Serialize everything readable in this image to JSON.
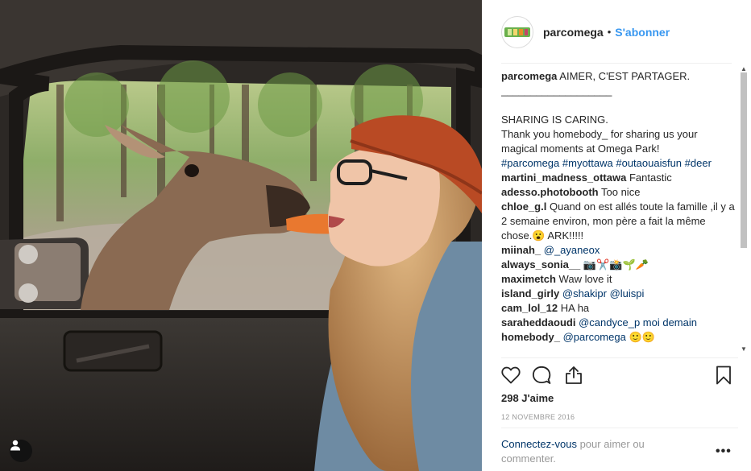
{
  "post": {
    "username": "parcomega",
    "follow_label": "S'abonner",
    "separator": "•",
    "caption": {
      "username": "parcomega",
      "title": "AIMER, C'EST PARTAGER.",
      "rule": "___________________",
      "body_line1": "SHARING IS CARING.",
      "body_line2": "Thank you homebody_ for sharing us your magical moments at Omega Park!",
      "hashtags": "#parcomega #myottawa #outaouaisfun #deer"
    },
    "comments": [
      {
        "user": "martini_madness_ottawa",
        "text": "Fantastic"
      },
      {
        "user": "adesso.photobooth",
        "text": "Too nice"
      },
      {
        "user": "chloe_g.l",
        "text": "Quand on est allés toute la famille ,il y a 2 semaine environ, mon père a fait la même chose.😮 ARK!!!!!"
      },
      {
        "user": "miinah_",
        "text": "@_ayaneox"
      },
      {
        "user": "always_sonia__",
        "text": "📷✂️📸🌱🥕"
      },
      {
        "user": "maximetch",
        "text": "Waw love it"
      },
      {
        "user": "island_girly",
        "text": "@shakipr @luispi"
      },
      {
        "user": "cam_lol_12",
        "text": "HA ha"
      },
      {
        "user": "saraheddaoudi",
        "text": "@candyce_p moi demain"
      },
      {
        "user": "homebody_",
        "text": "@parcomega 🙂🙂"
      }
    ],
    "likes": "298 J'aime",
    "date": "12 NOVEMBRE 2016",
    "login_link": "Connectez-vous",
    "login_text": " pour aimer ou commenter.",
    "more_label": "•••"
  },
  "icons": {
    "like": "heart-icon",
    "comment": "comment-bubble-icon",
    "share": "share-icon",
    "save": "bookmark-icon",
    "user_tags": "user-icon"
  },
  "colors": {
    "link_blue": "#3897f0",
    "hashtag": "#003569",
    "muted": "#999999"
  }
}
